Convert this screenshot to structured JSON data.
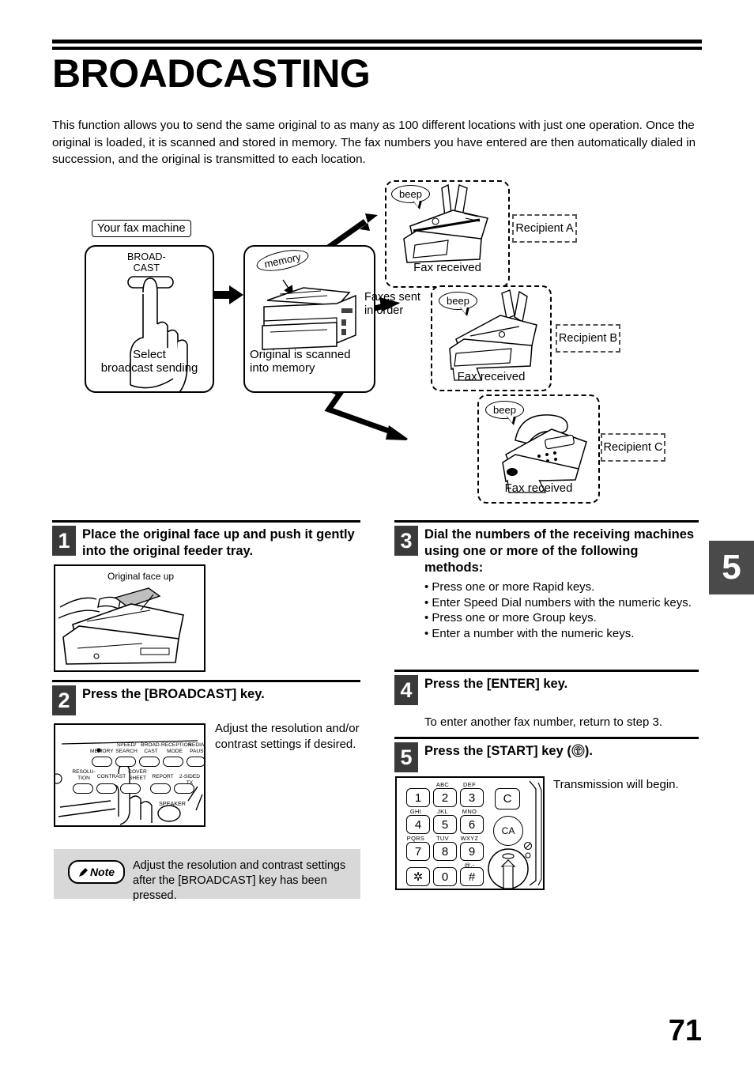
{
  "header": {
    "title": "BROADCASTING",
    "intro": "This function allows you to send the same original to as many as 100 different locations with just one operation. Once the original is loaded, it is scanned and stored in memory. The fax numbers you have entered are then automatically dialed in succession, and the original is transmitted to each location."
  },
  "chapter_tab": "5",
  "page_number": "71",
  "diagram": {
    "your_fax_machine_tag": "Your fax machine",
    "broadcast_key_label": "BROAD-\nCAST",
    "select_caption": "Select\nbroadcast sending",
    "memory_bubble": "memory",
    "scanned_caption": "Original is scanned\ninto memory",
    "faxes_sent_label": "Faxes sent\nin order",
    "beep": "beep",
    "fax_received": "Fax received",
    "recipients": [
      {
        "label": "Recipient A"
      },
      {
        "label": "Recipient B"
      },
      {
        "label": "Recipient C"
      }
    ]
  },
  "steps": [
    {
      "number": "1",
      "title": "Place the original face up and push it gently into the original feeder tray.",
      "illustration_label": "Original face up"
    },
    {
      "number": "2",
      "title": "Press the [BROADCAST] key.",
      "body": "Adjust the resolution and/or contrast settings if desired.",
      "panel_keys_row1": [
        "MEMORY",
        "SPEED/\nSEARCH",
        "BROAD-\nCAST",
        "RECEPTION\nMODE",
        "REDIAL/\nPAUSE"
      ],
      "panel_keys_row2": [
        "RESOLU-\nTION",
        "CONTRAST",
        "COVER\nSHEET",
        "REPORT",
        "2-SIDED TX"
      ],
      "panel_speaker": "SPEAKER"
    },
    {
      "number": "3",
      "title": "Dial the numbers of the receiving machines using one or more of the following methods:",
      "bullets": [
        "Press one or more Rapid keys.",
        "Enter Speed Dial numbers with the numeric keys.",
        "Press one or more Group keys.",
        "Enter a number with the numeric keys."
      ]
    },
    {
      "number": "4",
      "title": "Press the [ENTER] key.",
      "body": "To enter another fax number, return to step 3."
    },
    {
      "number": "5",
      "title_before": "Press the [START] key (",
      "title_after": ").",
      "body": "Transmission will begin."
    }
  ],
  "note": {
    "badge": "Note",
    "text": "Adjust the resolution and contrast settings after the [BROADCAST] key has been pressed."
  },
  "keypad": {
    "keys": [
      {
        "digit": "1",
        "letters": ""
      },
      {
        "digit": "2",
        "letters": "ABC"
      },
      {
        "digit": "3",
        "letters": "DEF"
      },
      {
        "digit": "4",
        "letters": "GHI"
      },
      {
        "digit": "5",
        "letters": "JKL"
      },
      {
        "digit": "6",
        "letters": "MNO"
      },
      {
        "digit": "7",
        "letters": "PQRS"
      },
      {
        "digit": "8",
        "letters": "TUV"
      },
      {
        "digit": "9",
        "letters": "WXYZ"
      },
      {
        "digit": "✲",
        "letters": ""
      },
      {
        "digit": "0",
        "letters": ""
      },
      {
        "digit": "#",
        "letters": "@.-"
      }
    ],
    "clear_key": "C",
    "clear_all_key": "CA"
  },
  "colors": {
    "step_number_bg": "#3a3a3a",
    "chapter_tab_bg": "#4a4a4a",
    "note_bg": "#d8d8d8",
    "rule": "#000000"
  }
}
